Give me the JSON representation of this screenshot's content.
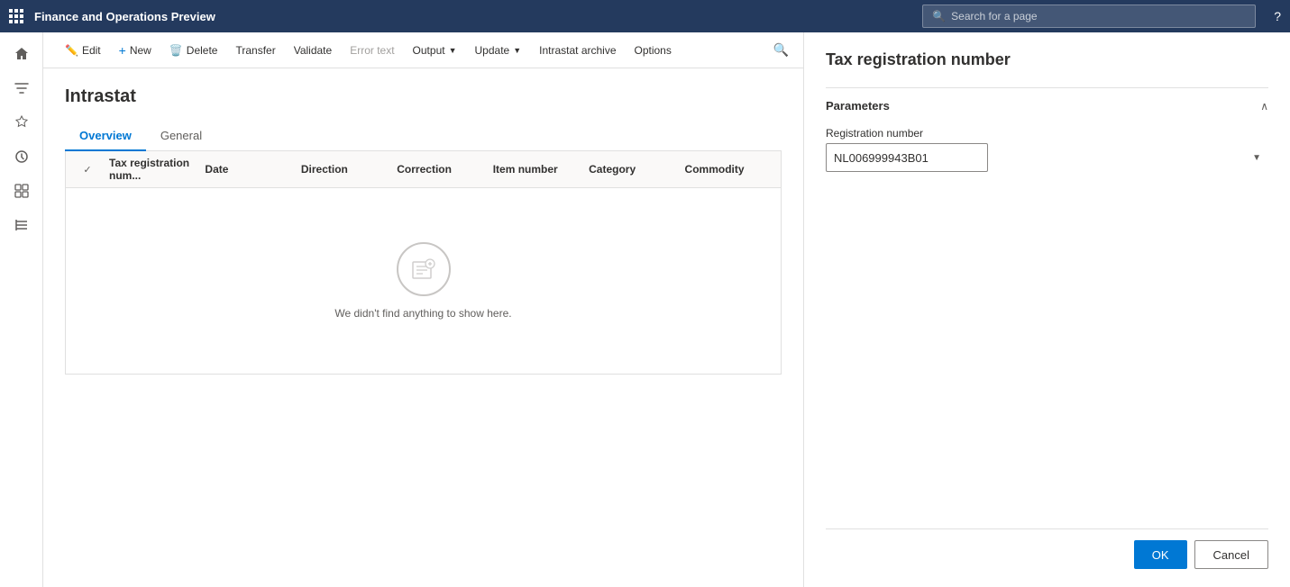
{
  "app": {
    "title": "Finance and Operations Preview",
    "search_placeholder": "Search for a page"
  },
  "toolbar": {
    "edit_label": "Edit",
    "new_label": "New",
    "delete_label": "Delete",
    "transfer_label": "Transfer",
    "validate_label": "Validate",
    "error_text_label": "Error text",
    "output_label": "Output",
    "update_label": "Update",
    "intrastat_archive_label": "Intrastat archive",
    "options_label": "Options"
  },
  "page": {
    "title": "Intrastat",
    "tabs": [
      {
        "label": "Overview",
        "active": true
      },
      {
        "label": "General",
        "active": false
      }
    ]
  },
  "table": {
    "columns": [
      "Tax registration num...",
      "Date",
      "Direction",
      "Correction",
      "Item number",
      "Category",
      "Commodity"
    ]
  },
  "empty_state": {
    "message": "We didn't find anything to show here."
  },
  "right_panel": {
    "title": "Tax registration number",
    "section_title": "Parameters",
    "registration_number_label": "Registration number",
    "registration_number_value": "NL006999943B01",
    "ok_label": "OK",
    "cancel_label": "Cancel"
  },
  "sidebar": {
    "icons": [
      {
        "name": "home-icon",
        "symbol": "⌂"
      },
      {
        "name": "filter-icon",
        "symbol": "⊟"
      },
      {
        "name": "favorites-icon",
        "symbol": "☆"
      },
      {
        "name": "recent-icon",
        "symbol": "◷"
      },
      {
        "name": "workspaces-icon",
        "symbol": "▦"
      },
      {
        "name": "modules-icon",
        "symbol": "≡"
      }
    ]
  }
}
